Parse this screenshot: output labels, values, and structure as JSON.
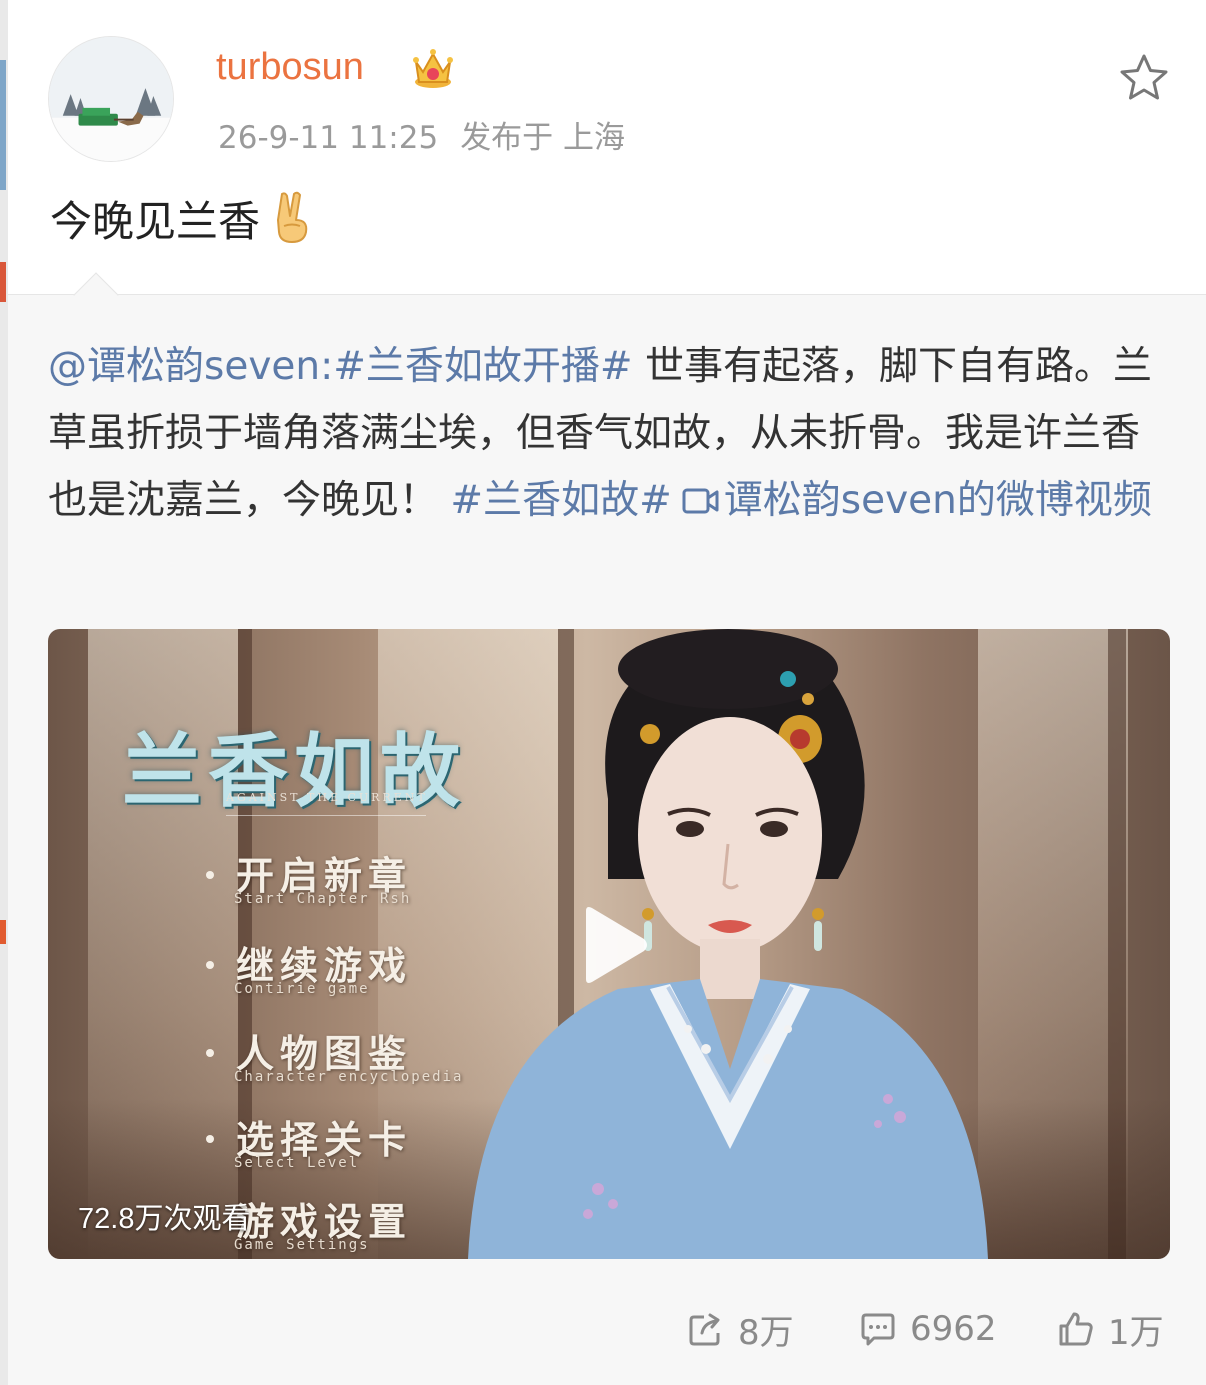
{
  "post": {
    "username": "turbosun",
    "timestamp": "26-9-11 11:25",
    "location": "发布于 上海",
    "text": "今晚见兰香"
  },
  "repost": {
    "mention": "@谭松韵seven:",
    "hashtag1": "#兰香如故开播#",
    "body": " 世事有起落，脚下自有路。兰草虽折损于墙角落满尘埃，但香气如故，从未折骨。我是许兰香也是沈嘉兰，今晚见！ ",
    "hashtag2": "#兰香如故#",
    "video_link": "谭松韵seven的微博视频"
  },
  "video": {
    "views": "72.8万次观看",
    "title": "兰香如故",
    "subtitle": "AGAINST THE CURRENT",
    "menu": [
      {
        "zh": "开启新章",
        "en": "Start Chapter Rsh"
      },
      {
        "zh": "继续游戏",
        "en": "Contirie game"
      },
      {
        "zh": "人物图鉴",
        "en": "Character encyclopedia"
      },
      {
        "zh": "选择关卡",
        "en": "Select Level"
      },
      {
        "zh": "游戏设置",
        "en": "Game Settings"
      }
    ]
  },
  "actions": {
    "repost_count": "8万",
    "comment_count": "6962",
    "like_count": "1万"
  },
  "colors": {
    "username": "#eb7340",
    "link": "#5c7aa8",
    "meta": "#9a9a9a",
    "repost_bg": "#f7f7f7"
  },
  "icons": [
    "crown-icon",
    "star-icon",
    "victory-hand-emoji",
    "video-camera-icon",
    "play-icon",
    "repost-icon",
    "comment-icon",
    "like-icon"
  ]
}
